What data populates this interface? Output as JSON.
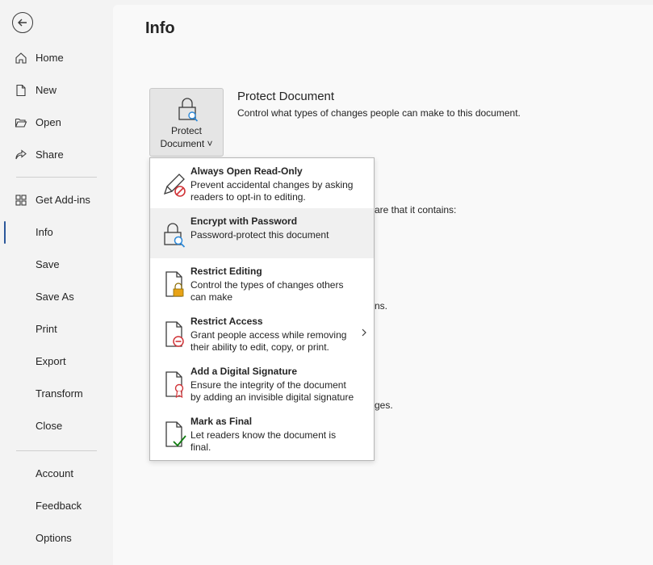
{
  "sidebar": {
    "items": [
      {
        "label": "Home"
      },
      {
        "label": "New"
      },
      {
        "label": "Open"
      },
      {
        "label": "Share"
      },
      {
        "label": "Get Add-ins"
      },
      {
        "label": "Info"
      },
      {
        "label": "Save"
      },
      {
        "label": "Save As"
      },
      {
        "label": "Print"
      },
      {
        "label": "Export"
      },
      {
        "label": "Transform"
      },
      {
        "label": "Close"
      },
      {
        "label": "Account"
      },
      {
        "label": "Feedback"
      },
      {
        "label": "Options"
      }
    ],
    "active": "Info"
  },
  "main": {
    "title": "Info",
    "protect": {
      "button_line1": "Protect",
      "button_line2": "Document ˅",
      "title": "Protect Document",
      "description": "Control what types of changes people can make to this document."
    },
    "background_fragments": [
      "are that it contains:",
      "ns.",
      "ges."
    ]
  },
  "menu": {
    "items": [
      {
        "title": "Always Open Read-Only",
        "desc1": "Prevent accidental changes by asking",
        "desc2": "readers to opt-in to editing.",
        "icon": "pencil-no-icon"
      },
      {
        "title": "Encrypt with Password",
        "desc1": "Password-protect this document",
        "desc2": "",
        "icon": "lock-key-icon"
      },
      {
        "title": "Restrict Editing",
        "desc1": "Control the types of changes others",
        "desc2": "can make",
        "icon": "document-lock-icon"
      },
      {
        "title": "Restrict Access",
        "desc1": "Grant people access while removing",
        "desc2": "their ability to edit, copy, or print.",
        "icon": "document-restrict-icon"
      },
      {
        "title": "Add a Digital Signature",
        "desc1": "Ensure the integrity of the document",
        "desc2": "by adding an invisible digital signature",
        "icon": "document-ribbon-icon"
      },
      {
        "title": "Mark as Final",
        "desc1": "Let readers know the document is",
        "desc2": "final.",
        "icon": "document-check-icon"
      }
    ]
  },
  "colors": {
    "accent": "#2b579a",
    "restrict_red": "#d13438",
    "lock_gold": "#e8a317",
    "check_green": "#107c10",
    "key_blue": "#2b88d8"
  }
}
